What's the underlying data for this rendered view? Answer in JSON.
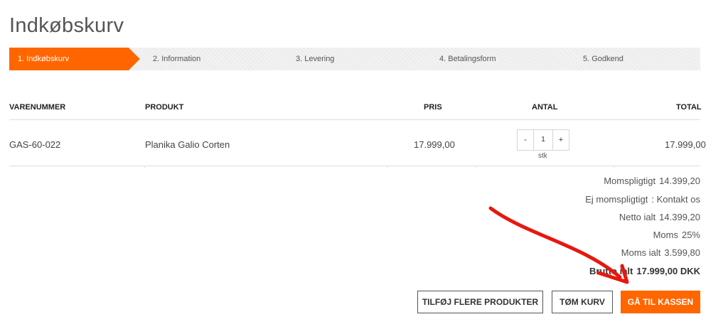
{
  "page": {
    "title": "Indkøbskurv"
  },
  "steps": [
    {
      "label": "1.  Indkøbskurv",
      "active": true
    },
    {
      "label": "2.  Information"
    },
    {
      "label": "3.  Levering"
    },
    {
      "label": "4.  Betalingsform"
    },
    {
      "label": "5.  Godkend"
    }
  ],
  "table": {
    "headers": {
      "item_number": "VARENUMMER",
      "product": "PRODUKT",
      "price": "PRIS",
      "quantity": "ANTAL",
      "total": "TOTAL"
    },
    "rows": [
      {
        "item_number": "GAS-60-022",
        "product": "Planika Galio Corten",
        "price": "17.999,00",
        "quantity": "1",
        "unit": "stk",
        "total": "17.999,00"
      }
    ]
  },
  "quantity_controls": {
    "decrement": "-",
    "increment": "+"
  },
  "totals": {
    "taxable": {
      "label": "Momspligtigt",
      "value": "14.399,20"
    },
    "non_taxable": {
      "label": "Ej momspligtigt",
      "value": ": Kontakt os"
    },
    "net": {
      "label": "Netto ialt",
      "value": "14.399,20"
    },
    "vat_rate": {
      "label": "Moms",
      "value": "25%"
    },
    "vat_total": {
      "label": "Moms ialt",
      "value": "3.599,80"
    },
    "gross": {
      "label": "Brutto ialt",
      "value": "17.999,00 DKK"
    }
  },
  "actions": {
    "add_more": "TILFØJ FLERE PRODUKTER",
    "empty_cart": "TØM KURV",
    "checkout": "GÅ TIL KASSEN"
  },
  "colors": {
    "accent": "#ff6600",
    "annotation": "#e8170f"
  }
}
